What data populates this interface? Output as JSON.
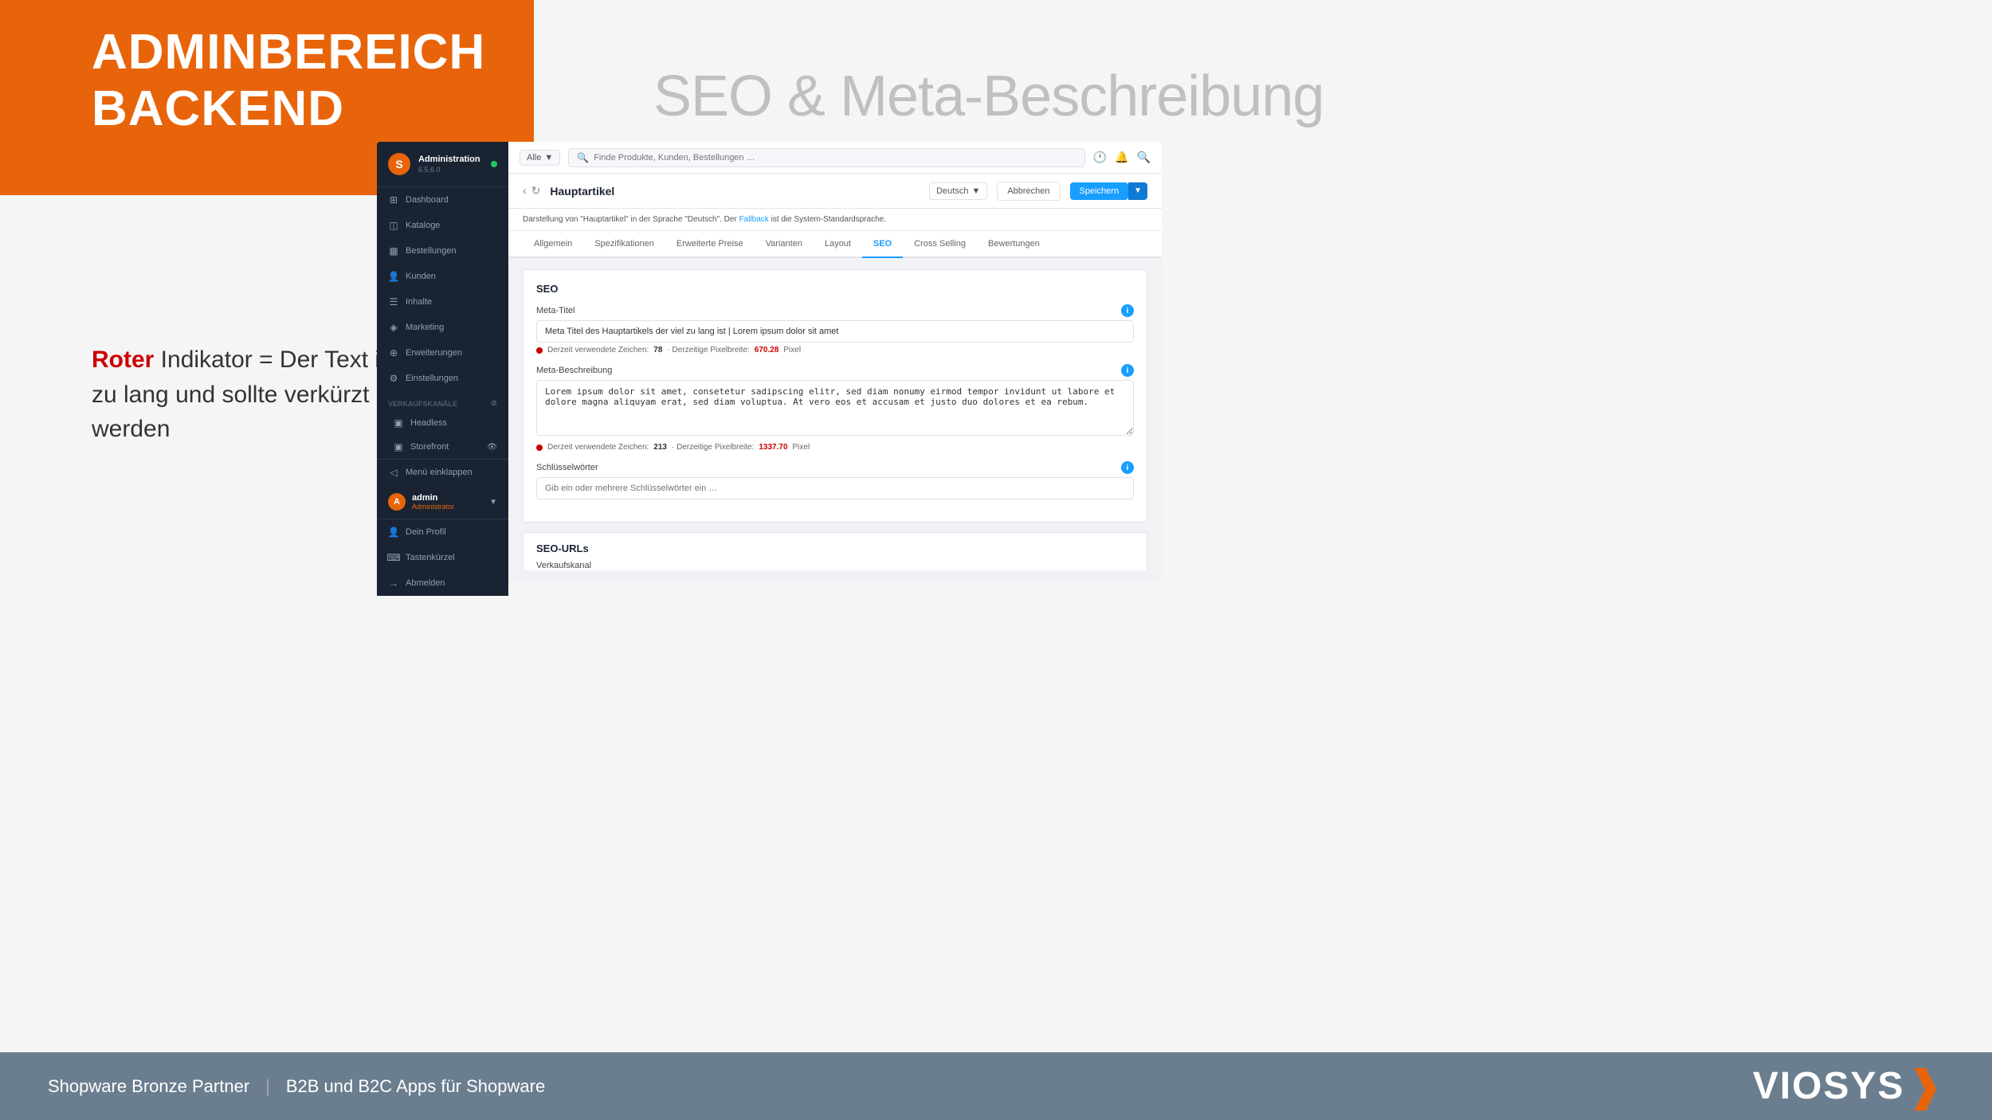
{
  "page": {
    "background_color": "#f5f5f5"
  },
  "orange_block": {
    "title_line1": "ADMINBEREICH",
    "title_line2": "BACKEND"
  },
  "seo_heading": "SEO & Meta-Beschreibung",
  "side_note": {
    "bold_red": "Roter",
    "normal": " Indikator = Der Text ist zu lang und sollte verkürzt werden"
  },
  "footer": {
    "left_text": "Shopware Bronze Partner",
    "separator": "|",
    "right_text": "B2B und B2C Apps für Shopware",
    "logo_text": "VIOSYS"
  },
  "sidebar": {
    "app_name": "Administration",
    "version": "6.5.6.0",
    "nav_items": [
      {
        "label": "Dashboard",
        "icon": "⊞"
      },
      {
        "label": "Kataloge",
        "icon": "⊟"
      },
      {
        "label": "Bestellungen",
        "icon": "▦"
      },
      {
        "label": "Kunden",
        "icon": "👤"
      },
      {
        "label": "Inhalte",
        "icon": "☰"
      },
      {
        "label": "Marketing",
        "icon": "📣"
      },
      {
        "label": "Erweiterungen",
        "icon": "⊕"
      },
      {
        "label": "Einstellungen",
        "icon": "⚙"
      }
    ],
    "verkaufskanaele": {
      "label": "Verkaufskanäle",
      "items": [
        {
          "label": "Headless",
          "icon": "▣"
        },
        {
          "label": "Storefront",
          "icon": "▣"
        }
      ]
    },
    "menu_einklappen": "Menü einklappen",
    "user": {
      "name": "admin",
      "role": "Administrator",
      "avatar": "A"
    },
    "user_menu": [
      {
        "label": "Dein Profil",
        "icon": "👤"
      },
      {
        "label": "Tastenkürzel",
        "icon": "⌨"
      },
      {
        "label": "Abmelden",
        "icon": "→"
      }
    ]
  },
  "topbar": {
    "all_label": "Alle",
    "search_placeholder": "Finde Produkte, Kunden, Bestellungen …"
  },
  "article_bar": {
    "title": "Hauptartikel",
    "language": "Deutsch",
    "cancel_btn": "Abbrechen",
    "save_btn": "Speichern"
  },
  "info_bar": {
    "text_before_link": "Darstellung von \"Hauptartikel\" in der Sprache \"Deutsch\". Der ",
    "link_text": "Fallback",
    "text_after_link": " ist die System-Standardsprache."
  },
  "tabs": [
    {
      "label": "Allgemein",
      "active": false
    },
    {
      "label": "Spezifikationen",
      "active": false
    },
    {
      "label": "Erweiterte Preise",
      "active": false
    },
    {
      "label": "Varianten",
      "active": false
    },
    {
      "label": "Layout",
      "active": false
    },
    {
      "label": "SEO",
      "active": true
    },
    {
      "label": "Cross Selling",
      "active": false
    },
    {
      "label": "Bewertungen",
      "active": false
    }
  ],
  "seo_card": {
    "title": "SEO",
    "meta_titel": {
      "label": "Meta-Titel",
      "value": "Meta Titel des Hauptartikels der viel zu lang ist | Lorem ipsum dolor sit amet",
      "char_info": {
        "prefix": "Derzeit verwendete Zeichen:",
        "chars": "78",
        "separator": " · Derzeitige Pixelbreite:",
        "pixels": "670.28",
        "suffix": "Pixel"
      }
    },
    "meta_beschreibung": {
      "label": "Meta-Beschreibung",
      "value": "Lorem ipsum dolor sit amet, consetetur sadipscing elitr, sed diam nonumy eirmod tempor invidunt ut labore et dolore magna aliquyam erat, sed diam voluptua. At vero eos et accusam et justo duo dolores et ea rebum.",
      "char_info": {
        "prefix": "Derzeit verwendete Zeichen:",
        "chars": "213",
        "separator": " · Derzeitige Pixelbreite:",
        "pixels": "1337.70",
        "suffix": "Pixel"
      }
    },
    "schlusselworter": {
      "label": "Schlüsselwörter",
      "placeholder": "Gib ein oder mehrere Schlüsselwörter ein …"
    }
  },
  "seo_urls_card": {
    "title": "SEO-URLs",
    "verkaufskanal_label": "Verkaufskanal"
  }
}
